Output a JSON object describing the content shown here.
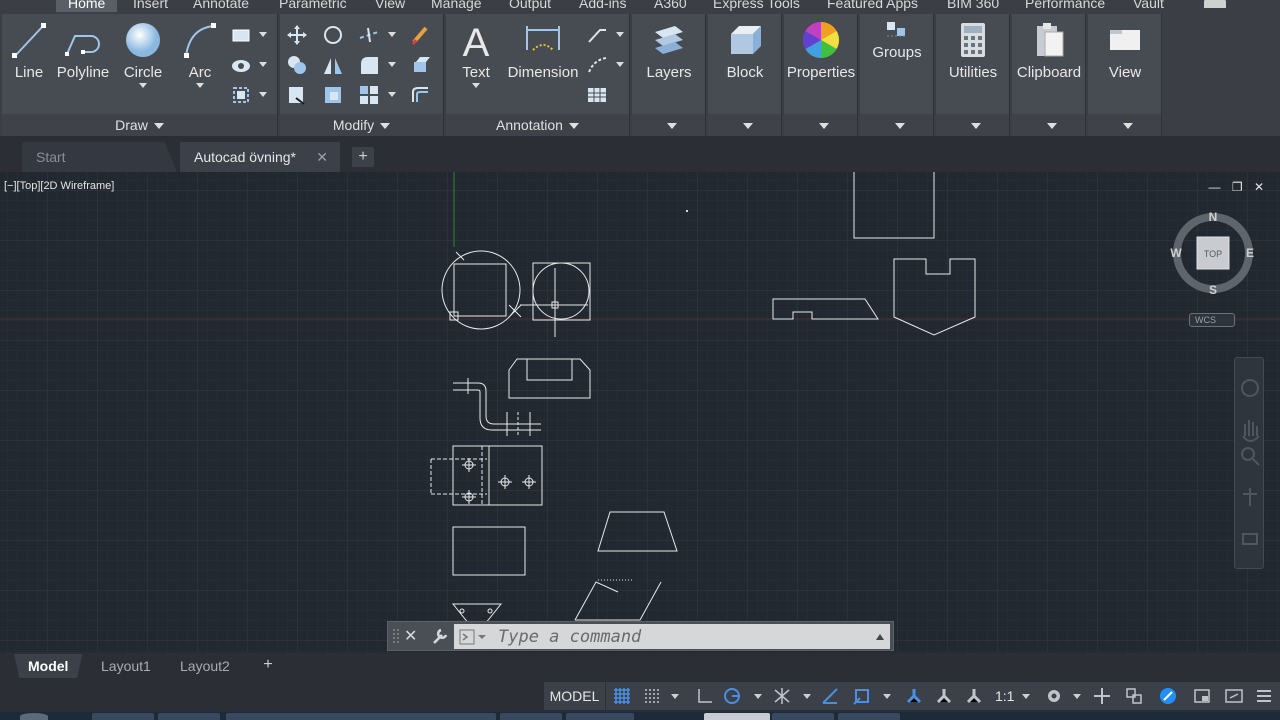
{
  "ribbon_tabs": [
    "Home",
    "Insert",
    "Annotate",
    "Parametric",
    "View",
    "Manage",
    "Output",
    "Add-ins",
    "A360",
    "Express Tools",
    "Featured Apps",
    "BIM 360",
    "Performance",
    "Vault"
  ],
  "panels": {
    "draw": {
      "title": "Draw",
      "buttons": [
        "Line",
        "Polyline",
        "Circle",
        "Arc"
      ]
    },
    "modify": {
      "title": "Modify"
    },
    "annotation": {
      "title": "Annotation",
      "buttons": [
        "Text",
        "Dimension"
      ]
    },
    "layers": {
      "label": "Layers"
    },
    "block": {
      "label": "Block"
    },
    "properties": {
      "label": "Properties"
    },
    "groups": {
      "label": "Groups"
    },
    "utilities": {
      "label": "Utilities"
    },
    "clipboard": {
      "label": "Clipboard"
    },
    "view": {
      "label": "View"
    }
  },
  "doc_tabs": {
    "start": "Start",
    "drawing": "Autocad övning*",
    "close_glyph": "✕",
    "add_glyph": "+"
  },
  "viewport": {
    "label": "[−][Top][2D Wireframe]",
    "controls": [
      "—",
      "❐",
      "✕"
    ]
  },
  "viewcube": {
    "n": "N",
    "s": "S",
    "e": "E",
    "w": "W",
    "face": "TOP",
    "wcs": "WCS"
  },
  "command_line": {
    "placeholder": "Type a command",
    "close_glyph": "✕"
  },
  "layout_tabs": [
    "Model",
    "Layout1",
    "Layout2"
  ],
  "layout_add_glyph": "+",
  "status": {
    "model": "MODEL",
    "scale": "1:1"
  },
  "colors": {
    "background": "#212830",
    "ribbon": "#3b3e44",
    "panel": "#474b52",
    "linework": "#e8eaec",
    "y_axis": "#2f8a2f",
    "x_axis": "#8a2f2f",
    "accent": "#1e90ff"
  }
}
